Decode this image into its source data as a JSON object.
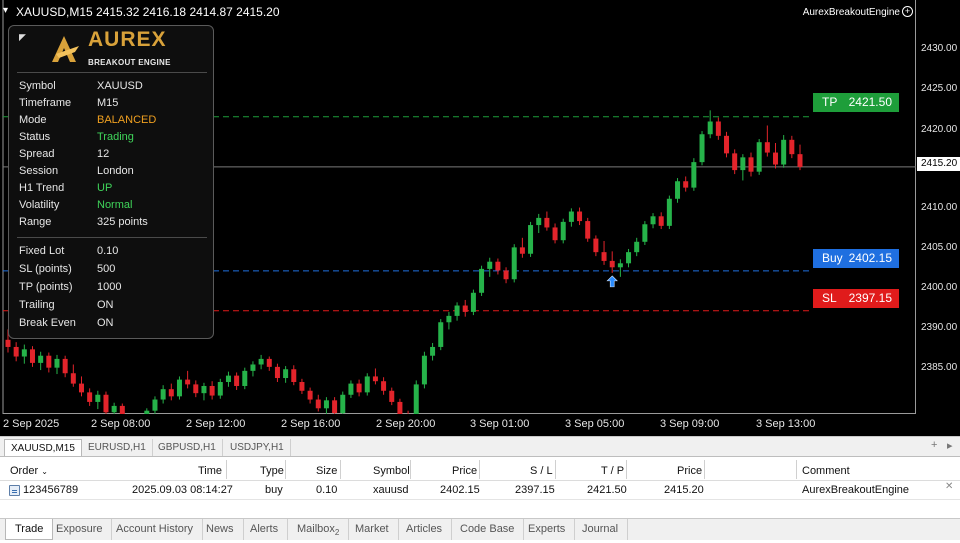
{
  "chart": {
    "header": "XAUUSD,M15  2415.32 2416.18 2414.87 2415.20",
    "expert_name": "AurexBreakoutEngine",
    "current_price": "2415.20",
    "y_ticks": [
      "2430.00",
      "2425.00",
      "2420.00",
      "2410.00",
      "2405.00",
      "2400.00",
      "2390.00",
      "2385.00"
    ],
    "x_ticks": [
      "2 Sep 2025",
      "2 Sep 08:00",
      "2 Sep 12:00",
      "2 Sep 16:00",
      "2 Sep 20:00",
      "3 Sep 01:00",
      "3 Sep 05:00",
      "3 Sep 09:00",
      "3 Sep 13:00"
    ],
    "levels": {
      "tp": {
        "name": "TP",
        "value": "2421.50",
        "color": "#1e9e3a"
      },
      "buy": {
        "name": "Buy",
        "value": "2402.15",
        "color": "#1f6fe0"
      },
      "sl": {
        "name": "SL",
        "value": "2397.15",
        "color": "#e01b1b"
      }
    },
    "colors": {
      "bull": "#26b34a",
      "bear": "#e3242b",
      "background": "#000000"
    }
  },
  "panel": {
    "logo_text": "AUREX",
    "logo_sub": "BREAKOUT ENGINE",
    "rows": [
      {
        "k": "Symbol",
        "v": "XAUUSD",
        "color": "#e6e6e6"
      },
      {
        "k": "Timeframe",
        "v": "M15",
        "color": "#e6e6e6"
      },
      {
        "k": "Mode",
        "v": "BALANCED",
        "color": "#f0a020"
      },
      {
        "k": "Status",
        "v": "Trading",
        "color": "#3fd45a"
      },
      {
        "k": "Spread",
        "v": "12",
        "color": "#e6e6e6"
      },
      {
        "k": "Session",
        "v": "London",
        "color": "#e6e6e6"
      },
      {
        "k": "H1 Trend",
        "v": "UP",
        "color": "#3fd45a"
      },
      {
        "k": "Volatility",
        "v": "Normal",
        "color": "#3fd45a"
      },
      {
        "k": "Range",
        "v": "325 points",
        "color": "#e6e6e6"
      }
    ],
    "settings": [
      {
        "k": "Fixed Lot",
        "v": "0.10"
      },
      {
        "k": "SL (points)",
        "v": "500"
      },
      {
        "k": "TP (points)",
        "v": "1000"
      },
      {
        "k": "Trailing",
        "v": "ON"
      },
      {
        "k": "Break Even",
        "v": "ON"
      }
    ]
  },
  "symbol_tabs": [
    "XAUUSD,M15",
    "EURUSD,H1",
    "GBPUSD,H1",
    "USDJPY,H1"
  ],
  "table": {
    "headers": {
      "order": "Order",
      "time": "Time",
      "type": "Type",
      "size": "Size",
      "symbol": "Symbol",
      "price": "Price",
      "sl": "S / L",
      "tp": "T / P",
      "price2": "Price",
      "comment": "Comment"
    },
    "row": {
      "order": "123456789",
      "time": "2025.09.03 08:14:27",
      "type": "buy",
      "size": "0.10",
      "symbol": "xauusd",
      "price": "2402.15",
      "sl": "2397.15",
      "tp": "2421.50",
      "price2": "2415.20",
      "comment": "AurexBreakoutEngine"
    }
  },
  "bottom_tabs": [
    "Trade",
    "Exposure",
    "Account History",
    "News",
    "Alerts",
    "Mailbox",
    "Market",
    "Articles",
    "Code Base",
    "Experts",
    "Journal"
  ],
  "mailbox_badge": "2",
  "candles": [
    [
      2393.5,
      2394.8,
      2391.9,
      2392.6
    ],
    [
      2392.6,
      2393.2,
      2390.8,
      2391.4
    ],
    [
      2391.4,
      2392.9,
      2390.5,
      2392.3
    ],
    [
      2392.3,
      2392.7,
      2390.1,
      2390.6
    ],
    [
      2390.6,
      2392.0,
      2389.7,
      2391.5
    ],
    [
      2391.5,
      2391.9,
      2389.4,
      2390.0
    ],
    [
      2390.0,
      2391.6,
      2389.2,
      2391.1
    ],
    [
      2391.1,
      2391.5,
      2388.8,
      2389.3
    ],
    [
      2389.3,
      2390.4,
      2387.6,
      2388.0
    ],
    [
      2388.0,
      2388.9,
      2386.4,
      2386.9
    ],
    [
      2386.9,
      2387.4,
      2385.2,
      2385.7
    ],
    [
      2385.7,
      2387.1,
      2384.8,
      2386.6
    ],
    [
      2386.6,
      2387.0,
      2384.0,
      2384.4
    ],
    [
      2384.4,
      2385.6,
      2383.1,
      2385.2
    ],
    [
      2385.2,
      2385.5,
      2382.6,
      2383.0
    ],
    [
      2383.0,
      2384.1,
      2381.5,
      2382.1
    ],
    [
      2382.1,
      2383.7,
      2381.2,
      2383.3
    ],
    [
      2383.3,
      2384.9,
      2382.8,
      2384.6
    ],
    [
      2384.6,
      2386.4,
      2384.1,
      2386.0
    ],
    [
      2386.0,
      2387.8,
      2385.5,
      2387.3
    ],
    [
      2387.3,
      2388.0,
      2385.9,
      2386.4
    ],
    [
      2386.4,
      2388.9,
      2386.0,
      2388.5
    ],
    [
      2388.5,
      2389.6,
      2387.4,
      2387.9
    ],
    [
      2387.9,
      2388.4,
      2386.3,
      2386.8
    ],
    [
      2386.8,
      2388.1,
      2385.9,
      2387.7
    ],
    [
      2387.7,
      2388.3,
      2386.0,
      2386.5
    ],
    [
      2386.5,
      2388.6,
      2386.1,
      2388.2
    ],
    [
      2388.2,
      2389.5,
      2387.6,
      2389.0
    ],
    [
      2389.0,
      2389.4,
      2387.2,
      2387.7
    ],
    [
      2387.7,
      2390.0,
      2387.3,
      2389.6
    ],
    [
      2389.6,
      2390.8,
      2388.9,
      2390.4
    ],
    [
      2390.4,
      2391.6,
      2389.8,
      2391.1
    ],
    [
      2391.1,
      2391.4,
      2389.6,
      2390.1
    ],
    [
      2390.1,
      2390.5,
      2388.2,
      2388.7
    ],
    [
      2388.7,
      2390.2,
      2388.1,
      2389.8
    ],
    [
      2389.8,
      2390.3,
      2387.8,
      2388.2
    ],
    [
      2388.2,
      2388.6,
      2386.7,
      2387.1
    ],
    [
      2387.1,
      2387.5,
      2385.5,
      2386.0
    ],
    [
      2386.0,
      2386.6,
      2384.5,
      2384.9
    ],
    [
      2384.9,
      2386.3,
      2384.2,
      2385.9
    ],
    [
      2385.9,
      2386.3,
      2383.9,
      2384.3
    ],
    [
      2384.3,
      2387.0,
      2383.9,
      2386.6
    ],
    [
      2386.6,
      2388.4,
      2386.2,
      2388.0
    ],
    [
      2388.0,
      2388.5,
      2386.4,
      2386.9
    ],
    [
      2386.9,
      2389.3,
      2386.5,
      2388.9
    ],
    [
      2388.9,
      2389.9,
      2387.9,
      2388.3
    ],
    [
      2388.3,
      2388.8,
      2386.6,
      2387.1
    ],
    [
      2387.1,
      2387.5,
      2385.3,
      2385.7
    ],
    [
      2385.7,
      2386.1,
      2383.6,
      2384.1
    ],
    [
      2384.1,
      2384.6,
      2382.5,
      2383.0
    ],
    [
      2383.0,
      2388.4,
      2382.6,
      2387.9
    ],
    [
      2387.9,
      2392.0,
      2387.4,
      2391.5
    ],
    [
      2391.5,
      2393.1,
      2390.9,
      2392.6
    ],
    [
      2392.6,
      2396.1,
      2392.2,
      2395.7
    ],
    [
      2395.7,
      2397.0,
      2394.8,
      2396.5
    ],
    [
      2396.5,
      2398.2,
      2395.9,
      2397.8
    ],
    [
      2397.8,
      2398.5,
      2396.4,
      2397.0
    ],
    [
      2397.0,
      2399.8,
      2396.6,
      2399.4
    ],
    [
      2399.4,
      2402.8,
      2399.0,
      2402.4
    ],
    [
      2402.4,
      2403.8,
      2401.4,
      2403.3
    ],
    [
      2403.3,
      2403.7,
      2401.7,
      2402.2
    ],
    [
      2402.2,
      2402.6,
      2400.6,
      2401.1
    ],
    [
      2401.1,
      2405.5,
      2400.7,
      2405.1
    ],
    [
      2405.1,
      2406.3,
      2403.8,
      2404.3
    ],
    [
      2404.3,
      2408.3,
      2403.9,
      2407.9
    ],
    [
      2407.9,
      2409.3,
      2406.9,
      2408.8
    ],
    [
      2408.8,
      2409.6,
      2407.2,
      2407.6
    ],
    [
      2407.6,
      2408.1,
      2405.6,
      2406.0
    ],
    [
      2406.0,
      2408.7,
      2405.6,
      2408.3
    ],
    [
      2408.3,
      2410.0,
      2407.7,
      2409.6
    ],
    [
      2409.6,
      2410.1,
      2407.9,
      2408.4
    ],
    [
      2408.4,
      2408.8,
      2405.8,
      2406.2
    ],
    [
      2406.2,
      2406.6,
      2404.0,
      2404.5
    ],
    [
      2404.5,
      2405.9,
      2402.9,
      2403.4
    ],
    [
      2403.4,
      2404.6,
      2401.9,
      2402.6
    ],
    [
      2402.6,
      2403.6,
      2401.4,
      2403.1
    ],
    [
      2403.1,
      2404.9,
      2402.6,
      2404.5
    ],
    [
      2404.5,
      2406.3,
      2404.0,
      2405.8
    ],
    [
      2405.8,
      2408.4,
      2405.4,
      2408.0
    ],
    [
      2408.0,
      2409.4,
      2407.5,
      2409.0
    ],
    [
      2409.0,
      2409.5,
      2407.4,
      2407.8
    ],
    [
      2407.8,
      2411.6,
      2407.4,
      2411.2
    ],
    [
      2411.2,
      2413.8,
      2410.7,
      2413.4
    ],
    [
      2413.4,
      2414.0,
      2412.1,
      2412.6
    ],
    [
      2412.6,
      2416.3,
      2412.2,
      2415.8
    ],
    [
      2415.8,
      2419.7,
      2415.4,
      2419.3
    ],
    [
      2419.3,
      2422.3,
      2418.8,
      2420.9
    ],
    [
      2420.9,
      2421.4,
      2418.6,
      2419.1
    ],
    [
      2419.1,
      2419.6,
      2416.4,
      2416.9
    ],
    [
      2416.9,
      2417.4,
      2414.3,
      2414.8
    ],
    [
      2414.8,
      2416.8,
      2413.5,
      2416.4
    ],
    [
      2416.4,
      2417.0,
      2414.0,
      2414.6
    ],
    [
      2414.6,
      2418.7,
      2414.2,
      2418.3
    ],
    [
      2418.3,
      2420.4,
      2416.5,
      2417.0
    ],
    [
      2417.0,
      2418.2,
      2415.0,
      2415.5
    ],
    [
      2415.5,
      2419.2,
      2415.1,
      2418.6
    ],
    [
      2418.6,
      2419.1,
      2416.3,
      2416.8
    ],
    [
      2416.8,
      2418.0,
      2414.8,
      2415.2
    ]
  ]
}
